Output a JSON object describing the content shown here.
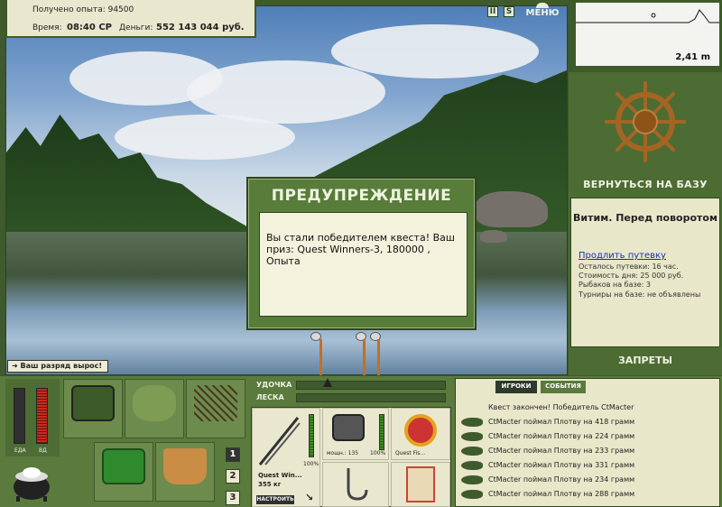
{
  "stats": {
    "experience_label": "Получено опыта: 94500",
    "time_label": "Время:",
    "time_value": "08:40 СР",
    "money_label": "Деньги:",
    "money_value": "552 143 044 руб."
  },
  "toolbar": {
    "pause_icon": "pause-icon",
    "sound_icon": "s-icon",
    "menu_label": "МЕНЮ"
  },
  "depth": {
    "value": "2,41 m"
  },
  "dialog": {
    "title": "ПРЕДУПРЕЖДЕНИЕ",
    "message": "Вы стали победителем квеста! Ваш приз: Quest Winners-3, 180000 , Опыта"
  },
  "rank_banner": "Ваш разряд вырос!",
  "right_panel": {
    "return_label": "ВЕРНУТЬСЯ НА БАЗУ",
    "base_name": "Витим. Перед поворотом",
    "extend_link": "Продлить путевку",
    "lines": [
      "Осталось путевки: 16 час.",
      "Стоимость дня: 25 000 руб.",
      "Рыбаков на базе: 3",
      "Турниры на базе: не объявлены"
    ],
    "bans_label": "ЗАПРЕТЫ"
  },
  "vitals": {
    "food_label": "ЕДА",
    "alcohol_label": "ВД"
  },
  "inventory_tabs": [
    "1",
    "2",
    "3"
  ],
  "meter": {
    "rod_label": "УДОЧКА",
    "line_label": "ЛЕСКА"
  },
  "tackle": {
    "rod_name": "Quest Win...",
    "rod_weight": "355 кг",
    "rod_percent": "100%",
    "reel_label": "мощн.: 135",
    "reel_percent": "100%",
    "line_name": "Quest Fis...",
    "setup_button": "НАСТРОИТЬ"
  },
  "events": {
    "tab_players": "ИГРОКИ",
    "tab_events": "СОБЫТИЯ",
    "quest_line": "Квест закончен! Победитель CtMacter",
    "catches": [
      "CtMacter поймал Плотву на 418 грамм",
      "CtMacter поймал Плотву на 224 грамм",
      "CtMacter поймал Плотву на 233 грамм",
      "CtMacter поймал Плотву на 331 грамм",
      "CtMacter поймал Плотву на 234 грамм",
      "CtMacter поймал Плотву на 288 грамм"
    ]
  }
}
